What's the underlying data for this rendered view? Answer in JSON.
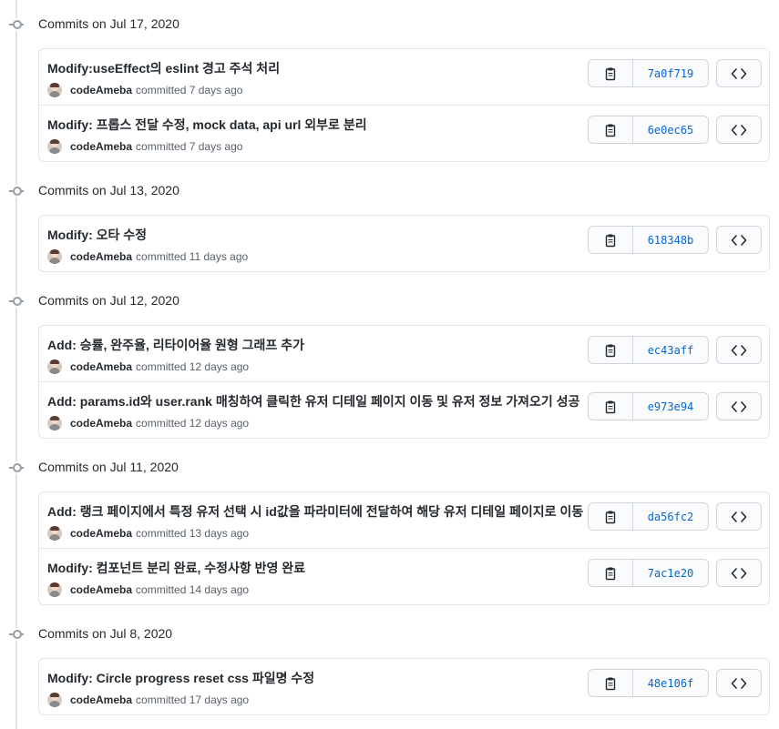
{
  "groups": [
    {
      "title": "Commits on Jul 17, 2020",
      "commits": [
        {
          "message": "Modify:useEffect의 eslint 경고 주석 처리",
          "author": "codeAmeba",
          "time": "committed 7 days ago",
          "sha": "7a0f719"
        },
        {
          "message": "Modify: 프롭스 전달 수정, mock data, api url 외부로 분리",
          "author": "codeAmeba",
          "time": "committed 7 days ago",
          "sha": "6e0ec65"
        }
      ]
    },
    {
      "title": "Commits on Jul 13, 2020",
      "commits": [
        {
          "message": "Modify: 오타 수정",
          "author": "codeAmeba",
          "time": "committed 11 days ago",
          "sha": "618348b"
        }
      ]
    },
    {
      "title": "Commits on Jul 12, 2020",
      "commits": [
        {
          "message": "Add: 승률, 완주율, 리타이어율 원형 그래프 추가",
          "author": "codeAmeba",
          "time": "committed 12 days ago",
          "sha": "ec43aff"
        },
        {
          "message": "Add: params.id와 user.rank 매칭하여 클릭한 유저 디테일 페이지 이동 및 유저 정보 가져오기 성공",
          "author": "codeAmeba",
          "time": "committed 12 days ago",
          "sha": "e973e94"
        }
      ]
    },
    {
      "title": "Commits on Jul 11, 2020",
      "commits": [
        {
          "message": "Add: 랭크 페이지에서 특정 유저 선택 시 id값을 파라미터에 전달하여 해당 유저 디테일 페이지로 이동",
          "author": "codeAmeba",
          "time": "committed 13 days ago",
          "sha": "da56fc2"
        },
        {
          "message": "Modify: 컴포넌트 분리 완료, 수정사항 반영 완료",
          "author": "codeAmeba",
          "time": "committed 14 days ago",
          "sha": "7ac1e20"
        }
      ]
    },
    {
      "title": "Commits on Jul 8, 2020",
      "commits": [
        {
          "message": "Modify: Circle progress reset css 파일명 수정",
          "author": "codeAmeba",
          "time": "committed 17 days ago",
          "sha": "48e106f"
        }
      ]
    }
  ],
  "icons": {
    "copy": "clipboard-icon",
    "browse": "code-icon",
    "node": "git-commit-icon"
  },
  "colors": {
    "sha_link": "#0366d6",
    "border": "#e1e4e8",
    "muted": "#586069"
  }
}
